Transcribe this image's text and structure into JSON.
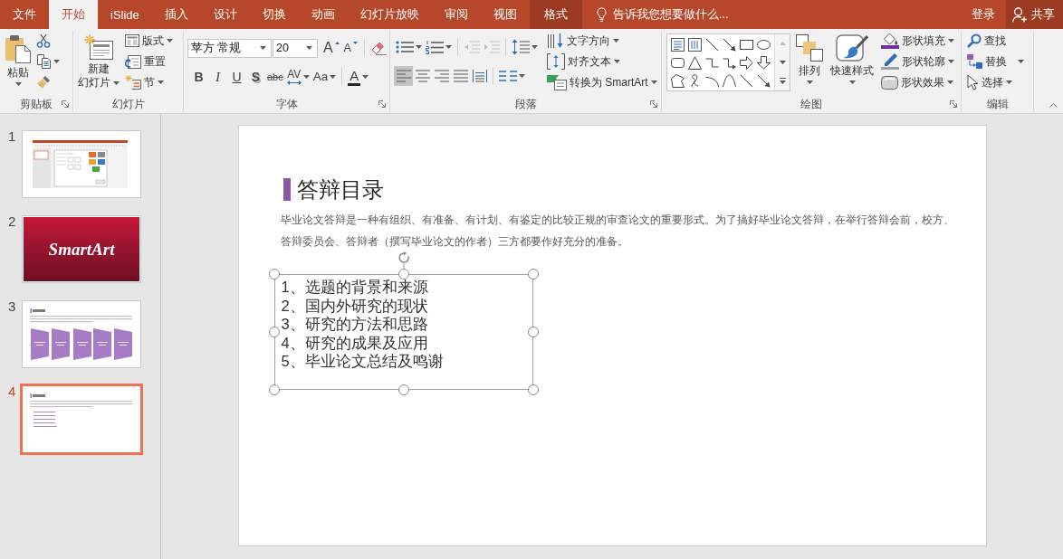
{
  "title_bar": {
    "tabs": [
      {
        "label": "文件",
        "kind": "standard",
        "selected": false
      },
      {
        "label": "开始",
        "kind": "standard",
        "selected": true
      },
      {
        "label": "iSlide",
        "kind": "standard",
        "selected": false
      },
      {
        "label": "插入",
        "kind": "standard",
        "selected": false
      },
      {
        "label": "设计",
        "kind": "standard",
        "selected": false
      },
      {
        "label": "切换",
        "kind": "standard",
        "selected": false
      },
      {
        "label": "动画",
        "kind": "standard",
        "selected": false
      },
      {
        "label": "幻灯片放映",
        "kind": "standard",
        "selected": false
      },
      {
        "label": "审阅",
        "kind": "standard",
        "selected": false
      },
      {
        "label": "视图",
        "kind": "standard",
        "selected": false
      },
      {
        "label": "格式",
        "kind": "contextual",
        "selected": false
      }
    ],
    "tell_me": "告诉我您想要做什么...",
    "sign_in": "登录",
    "share": "共享"
  },
  "ribbon": {
    "clipboard": {
      "label": "剪贴板",
      "paste": "粘贴"
    },
    "slides": {
      "label": "幻灯片",
      "new_slide": [
        "新建",
        "幻灯片"
      ],
      "layout": "版式",
      "reset": "重置",
      "section": "节"
    },
    "font": {
      "label": "字体",
      "font_name": "苹方 常规",
      "font_size": "20",
      "size_buttons": [
        {
          "kind": "grow",
          "glyph": "A"
        },
        {
          "kind": "shrink",
          "glyph": "A"
        }
      ],
      "format_buttons": [
        {
          "kind": "bold",
          "glyph": "B"
        },
        {
          "kind": "italic",
          "glyph": "I"
        },
        {
          "kind": "underline",
          "glyph": "U"
        },
        {
          "kind": "shadow",
          "glyph": "S"
        },
        {
          "kind": "strikethrough",
          "glyph": "abc"
        },
        {
          "kind": "spacing",
          "glyph": "AV"
        },
        {
          "kind": "case",
          "glyph": "Aa"
        }
      ],
      "font_color": {
        "glyph": "A"
      }
    },
    "paragraph": {
      "label": "段落",
      "indent_buttons": [
        {
          "kind": "decrease",
          "disabled": true
        },
        {
          "kind": "increase",
          "disabled": true
        }
      ],
      "alignments": [
        {
          "kind": "left",
          "selected": true
        },
        {
          "kind": "center",
          "selected": false
        },
        {
          "kind": "right",
          "selected": false
        },
        {
          "kind": "justify",
          "selected": false
        },
        {
          "kind": "distributed",
          "selected": false
        }
      ],
      "text_direction": "文字方向",
      "align_text": "对齐文本",
      "convert_smartart": "转换为 SmartArt"
    },
    "drawing": {
      "label": "绘图",
      "arrange": "排列",
      "quick_styles": "快速样式",
      "shape_fill": "形状填充",
      "shape_outline": "形状轮廓",
      "shape_effects": "形状效果"
    },
    "editing": {
      "label": "编辑",
      "find": "查找",
      "replace": "替换",
      "select": "选择"
    }
  },
  "slides": [
    {
      "number": "1",
      "kind": "screenshot",
      "selected": false
    },
    {
      "number": "2",
      "kind": "photo",
      "title": "SmartArt",
      "selected": false
    },
    {
      "number": "3",
      "kind": "process",
      "selected": false
    },
    {
      "number": "4",
      "kind": "list",
      "selected": true
    }
  ],
  "slide": {
    "title": "答辩目录",
    "body": "毕业论文答辩是一种有组织、有准备、有计划、有鉴定的比较正规的审查论文的重要形式。为了搞好毕业论文答辩，在举行答辩会前，校方、答辩委员会、答辩者（撰写毕业论文的作者）三方都要作好充分的准备。",
    "textbox": {
      "selected": true,
      "items": [
        "1、选题的背景和来源",
        "2、国内外研究的现状",
        "3、研究的方法和思路",
        "4、研究的成果及应用",
        "5、毕业论文总结及鸣谢"
      ]
    }
  }
}
